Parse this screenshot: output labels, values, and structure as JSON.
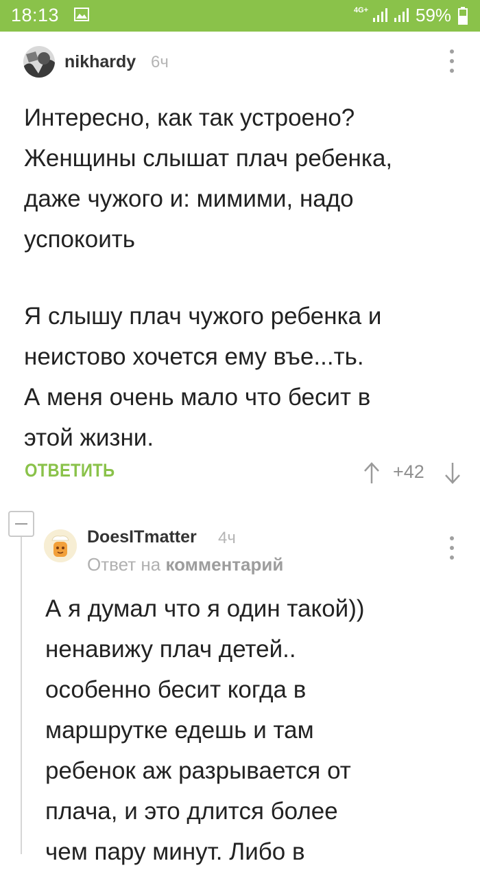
{
  "status_bar": {
    "time": "18:13",
    "network": "4G+",
    "battery": "59%"
  },
  "comment1": {
    "username": "nikhardy",
    "time_ago": "6ч",
    "paragraph1": "Интересно, как так устроено?\nЖенщины слышат плач ребенка,\nдаже чужого и: мимими, надо\nуспокоить",
    "paragraph2": "Я слышу плач чужого ребенка и\nнеистово хочется ему въе...ть.\nА меня очень мало что бесит в\nэтой жизни.",
    "reply_label": "ОТВЕТИТЬ",
    "rating": "+42"
  },
  "comment2": {
    "username": "DoesITmatter",
    "time_ago": "4ч",
    "reply_prefix": "Ответ на",
    "reply_target": "комментарий",
    "text": "А я думал что я один такой))\nненавижу плач детей..\nособенно бесит когда в\nмаршрутке едешь и там\nребенок аж разрывается от\nплача, и это длится более\nчем пару минут. Либо в"
  },
  "colors": {
    "accent": "#8ac24a",
    "muted": "#b5b5b5"
  },
  "icons": {
    "status": [
      "gallery-icon",
      "signal-icon",
      "battery-icon"
    ],
    "comment": [
      "more-vertical-icon",
      "arrow-up-icon",
      "arrow-down-icon",
      "collapse-icon"
    ]
  }
}
